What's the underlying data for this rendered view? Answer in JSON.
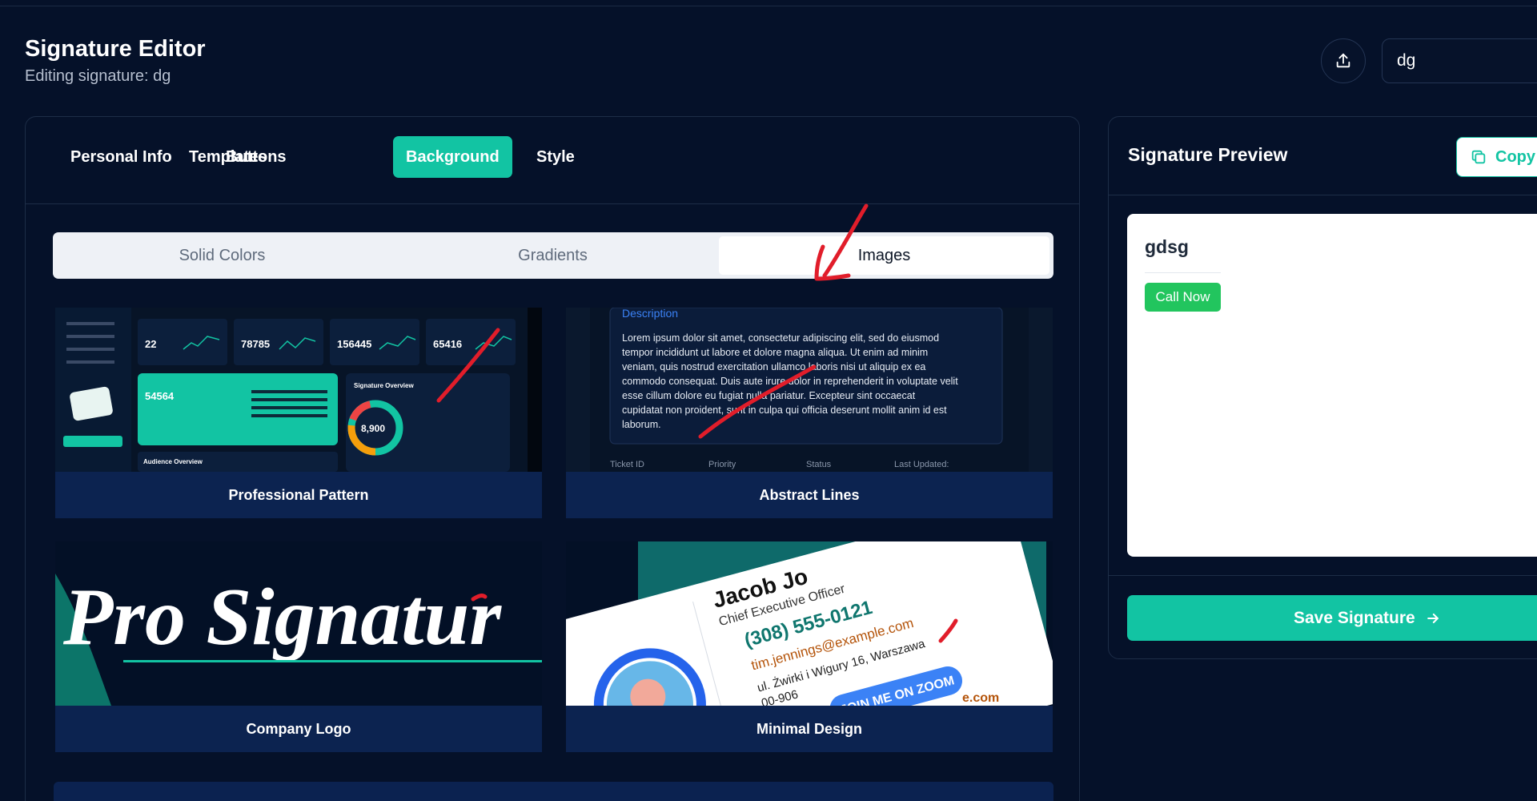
{
  "header": {
    "title": "Signature Editor",
    "subtitle": "Editing signature: dg",
    "upload_icon": "upload-icon",
    "name_value": "dg"
  },
  "tabs": [
    {
      "label": "Personal Info",
      "active": false
    },
    {
      "label": "Templates",
      "active": false
    },
    {
      "label": "Buttons",
      "active": false
    },
    {
      "label": "Background",
      "active": true
    },
    {
      "label": "Style",
      "active": false
    }
  ],
  "background_modes": [
    {
      "label": "Solid Colors",
      "active": false
    },
    {
      "label": "Gradients",
      "active": false
    },
    {
      "label": "Images",
      "active": true
    }
  ],
  "images": [
    {
      "label": "Professional Pattern",
      "thumb": {
        "stats": [
          "22",
          "78785",
          "156445",
          "65416"
        ],
        "highlight": "54564",
        "overview_title": "Signature Overview",
        "donut_value": "8,900",
        "audience": "Audience Overview"
      }
    },
    {
      "label": "Abstract Lines",
      "thumb": {
        "heading": "Description",
        "lines": [
          "Lorem ipsum dolor sit amet, consectetur adipiscing elit, sed do eiusmod",
          "tempor incididunt ut labore et dolore magna aliqua. Ut enim ad minim",
          "veniam, quis nostrud exercitation ullamco laboris nisi ut aliquip ex ea",
          "commodo consequat. Duis aute irure dolor in reprehenderit in voluptate velit",
          "esse cillum dolore eu fugiat nulla pariatur. Excepteur sint occaecat",
          "cupidatat non proident, sunt in culpa qui officia deserunt mollit anim id est",
          "laborum."
        ],
        "columns": [
          "Ticket ID",
          "Priority",
          "Status",
          "Last Updated:"
        ]
      }
    },
    {
      "label": "Company Logo",
      "thumb": {
        "text": "Pro Signatur"
      }
    },
    {
      "label": "Minimal Design",
      "thumb": {
        "name": "Jacob Jo",
        "role": "Chief Executive Officer",
        "phone": "(308) 555-0121",
        "email": "tim.jennings@example.com",
        "address": "ul. Żwirki i Wigury 16, Warszawa",
        "zip": "00-906",
        "zoom": "JOIN ME ON ZOOM",
        "footer": "e.com"
      }
    }
  ],
  "preview": {
    "title": "Signature Preview",
    "copy_label": "Copy",
    "copy_icon": "copy-icon",
    "signature_name": "gdsg",
    "call_label": "Call Now",
    "save_label": "Save Signature",
    "save_icon": "arrow-right-icon"
  },
  "colors": {
    "background": "#051129",
    "accent": "#12c4a3",
    "card": "#0b2250",
    "call_button": "#22c55e",
    "annotation": "#e11d2a"
  }
}
